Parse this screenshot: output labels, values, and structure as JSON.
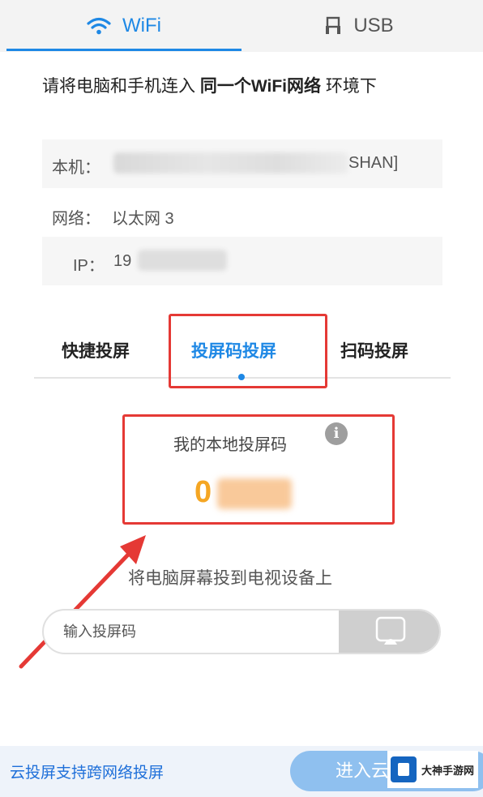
{
  "top_tabs": [
    {
      "label": "WiFi",
      "icon": "wifi-icon",
      "active": true
    },
    {
      "label": "USB",
      "icon": "usb-icon",
      "active": false
    }
  ],
  "hint": {
    "prefix": "请将电脑和手机连入 ",
    "bold": "同一个WiFi网络",
    "suffix": " 环境下"
  },
  "device": {
    "host_label": "本机：",
    "host_value_suffix": "SHAN]",
    "network_label": "网络：",
    "network_value": "以太网 3",
    "ip_label": "IP：",
    "ip_value_prefix": "19"
  },
  "mode_tabs": [
    "快捷投屏",
    "投屏码投屏",
    "扫码投屏"
  ],
  "active_mode_index": 1,
  "local_code": {
    "label": "我的本地投屏码",
    "info_icon": "info-icon",
    "code_prefix": "0"
  },
  "tv_cast": {
    "label": "将电脑屏幕投到电视设备上",
    "input_placeholder": "输入投屏码",
    "button_icon": "cast-icon"
  },
  "bottom": {
    "cloud_link": "云投屏支持跨网络投屏",
    "cloud_button": "进入云"
  },
  "watermark": {
    "text": "大神手游网"
  },
  "colors": {
    "accent": "#1e88e5",
    "highlight": "#e53935",
    "code": "#f5a623"
  }
}
